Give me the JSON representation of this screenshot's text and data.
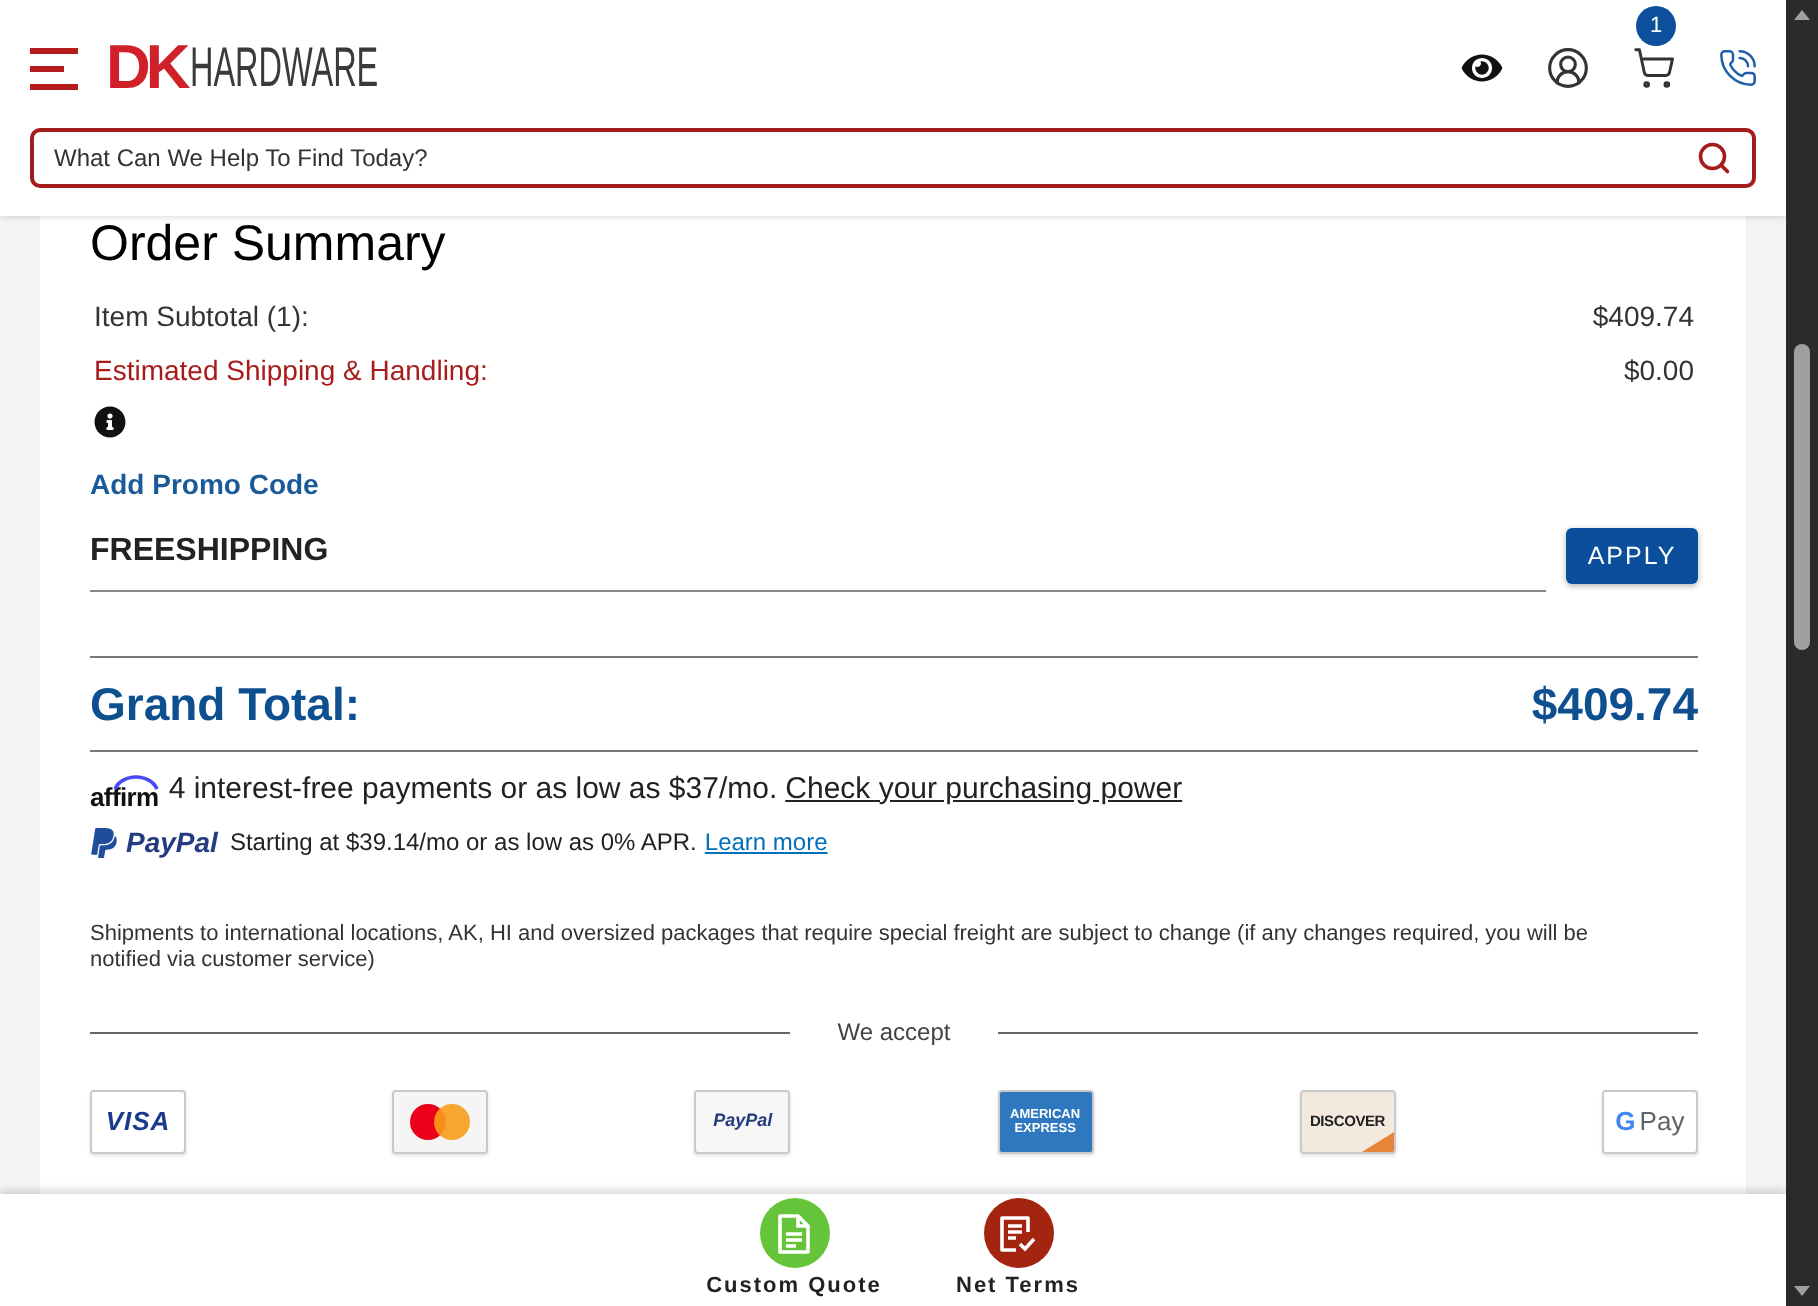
{
  "header": {
    "logo": {
      "mark": "DK",
      "wordmark": "HARDWARE"
    },
    "cart_count": "1",
    "search": {
      "placeholder": "What Can We Help To Find Today?"
    }
  },
  "order_summary": {
    "title": "Order Summary",
    "lines": [
      {
        "kind": "plain",
        "label": "Item Subtotal (1):",
        "value": "$409.74"
      },
      {
        "kind": "alert",
        "label": "Estimated Shipping & Handling:",
        "value": "$0.00"
      }
    ],
    "promo": {
      "link": "Add Promo Code",
      "code": "FREESHIPPING",
      "button": "APPLY"
    },
    "grand_total": {
      "label": "Grand Total:",
      "value": "$409.74"
    },
    "financing": [
      {
        "kind": "affirm",
        "brand": "affirm",
        "text": "4 interest-free payments or as low as $37/mo.",
        "link": "Check your purchasing power"
      },
      {
        "kind": "paypal",
        "brand": "PayPal",
        "text": "Starting at $39.14/mo or as low as 0% APR.",
        "link": "Learn more"
      }
    ],
    "note": "Shipments to international locations, AK, HI and oversized packages that require special freight are subject to change (if any changes required, you will be notified via customer service)",
    "accept_label": "We accept",
    "payment_methods": [
      {
        "kind": "visa",
        "label": "VISA"
      },
      {
        "kind": "mastercard"
      },
      {
        "kind": "paypal",
        "label": "PayPal"
      },
      {
        "kind": "amex",
        "label": "AMERICAN EXPRESS"
      },
      {
        "kind": "discover",
        "label": "DISCOVER"
      },
      {
        "kind": "gpay",
        "mark": "G",
        "label": "Pay"
      }
    ]
  },
  "bottom_bar": {
    "actions": [
      {
        "kind": "quote",
        "label": "Custom Quote",
        "color": "#66c43a"
      },
      {
        "kind": "terms",
        "label": "Net Terms",
        "color": "#a3240f"
      }
    ]
  }
}
